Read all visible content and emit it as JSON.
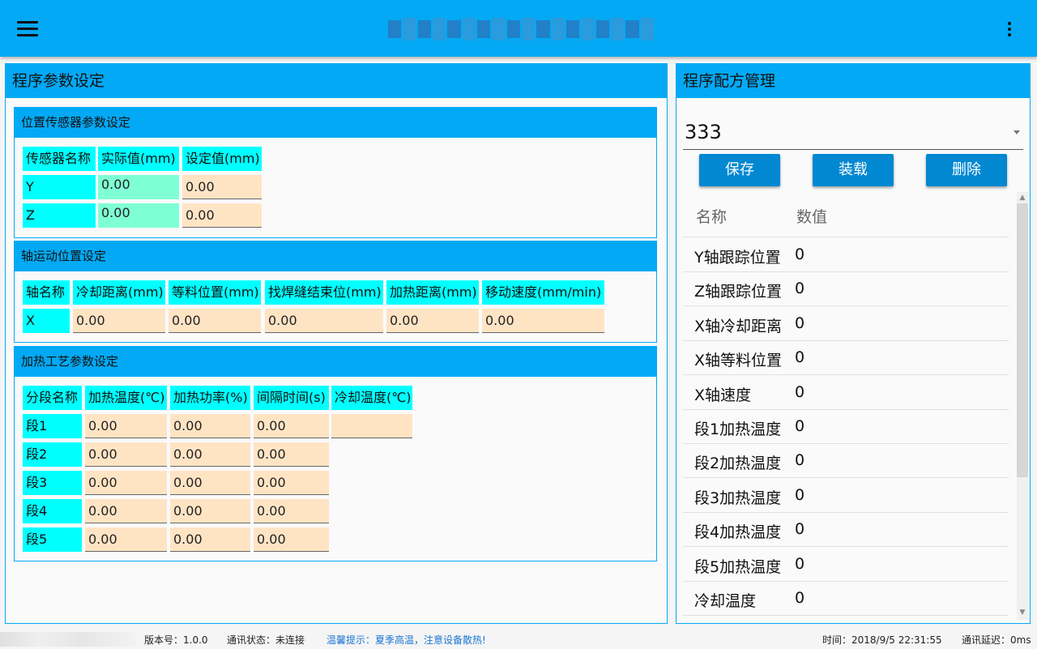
{
  "left_panel": {
    "title": "程序参数设定",
    "sensor": {
      "title": "位置传感器参数设定",
      "headers": [
        "传感器名称",
        "实际值(mm)",
        "设定值(mm)"
      ],
      "rows": [
        {
          "name": "Y",
          "actual": "0.00",
          "set": "0.00"
        },
        {
          "name": "Z",
          "actual": "0.00",
          "set": "0.00"
        }
      ]
    },
    "axis": {
      "title": "轴运动位置设定",
      "headers": [
        "轴名称",
        "冷却距离(mm)",
        "等料位置(mm)",
        "找焊缝结束位(mm)",
        "加热距离(mm)",
        "移动速度(mm/min)"
      ],
      "row": {
        "name": "X",
        "values": [
          "0.00",
          "0.00",
          "0.00",
          "0.00",
          "0.00"
        ]
      }
    },
    "heat": {
      "title": "加热工艺参数设定",
      "headers": [
        "分段名称",
        "加热温度(℃)",
        "加热功率(%)",
        "间隔时间(s)",
        "冷却温度(℃)"
      ],
      "rows": [
        {
          "name": "段1",
          "values": [
            "0.00",
            "0.00",
            "0.00"
          ],
          "cool": ""
        },
        {
          "name": "段2",
          "values": [
            "0.00",
            "0.00",
            "0.00"
          ]
        },
        {
          "name": "段3",
          "values": [
            "0.00",
            "0.00",
            "0.00"
          ]
        },
        {
          "name": "段4",
          "values": [
            "0.00",
            "0.00",
            "0.00"
          ]
        },
        {
          "name": "段5",
          "values": [
            "0.00",
            "0.00",
            "0.00"
          ]
        }
      ]
    }
  },
  "right_panel": {
    "title": "程序配方管理",
    "recipe": "333",
    "buttons": {
      "save": "保存",
      "load": "装载",
      "delete": "删除"
    },
    "list_headers": {
      "name": "名称",
      "value": "数值"
    },
    "items": [
      {
        "name": "Y轴跟踪位置",
        "value": "0"
      },
      {
        "name": "Z轴跟踪位置",
        "value": "0"
      },
      {
        "name": "X轴冷却距离",
        "value": "0"
      },
      {
        "name": "X轴等料位置",
        "value": "0"
      },
      {
        "name": "X轴速度",
        "value": "0"
      },
      {
        "name": "段1加热温度",
        "value": "0"
      },
      {
        "name": "段2加热温度",
        "value": "0"
      },
      {
        "name": "段3加热温度",
        "value": "0"
      },
      {
        "name": "段4加热温度",
        "value": "0"
      },
      {
        "name": "段5加热温度",
        "value": "0"
      },
      {
        "name": "冷却温度",
        "value": "0"
      }
    ]
  },
  "status": {
    "version": "版本号：1.0.0",
    "comm": "通讯状态：未连接",
    "tip": "温馨提示：夏季高温，注意设备散热!",
    "time": "时间：2018/9/5 22:31:55",
    "delay": "通讯延迟：0ms"
  },
  "colors": {
    "accent": "#03a9f4",
    "header_cell": "#00ffff",
    "input_cell": "#ffe4c4",
    "actual_cell": "#7fffd4",
    "button": "#0288d1"
  }
}
